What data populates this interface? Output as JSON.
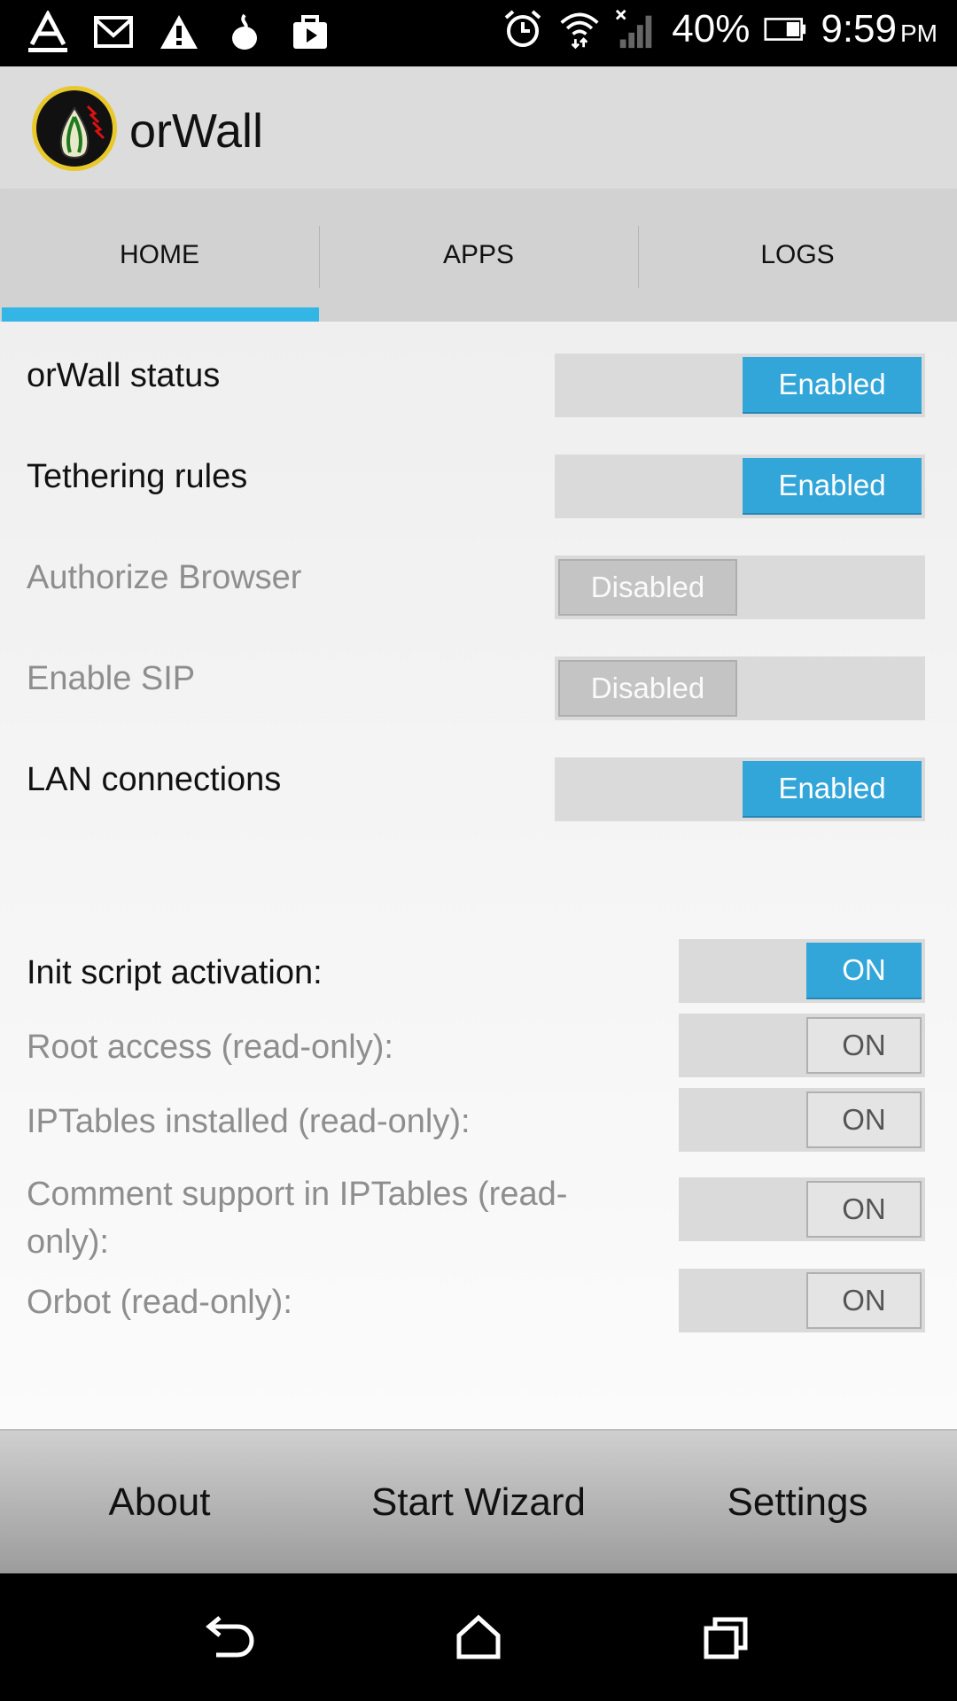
{
  "status_bar": {
    "icons_left": [
      "font-icon",
      "gmail-icon",
      "warning-icon",
      "lantern-icon",
      "play-store-icon"
    ],
    "icons_right": [
      "alarm-icon",
      "wifi-icon",
      "signal-icon"
    ],
    "battery": "40%",
    "time": "9:59",
    "ampm": "PM"
  },
  "app": {
    "title": "orWall"
  },
  "tabs": [
    {
      "label": "HOME",
      "selected": true
    },
    {
      "label": "APPS",
      "selected": false
    },
    {
      "label": "LOGS",
      "selected": false
    }
  ],
  "settings": [
    {
      "label": "orWall status",
      "state": "Enabled",
      "on": true,
      "enabled": true
    },
    {
      "label": "Tethering rules",
      "state": "Enabled",
      "on": true,
      "enabled": true
    },
    {
      "label": "Authorize Browser",
      "state": "Disabled",
      "on": false,
      "enabled": false
    },
    {
      "label": "Enable SIP",
      "state": "Disabled",
      "on": false,
      "enabled": false
    },
    {
      "label": "LAN connections",
      "state": "Enabled",
      "on": true,
      "enabled": true
    }
  ],
  "status_checks": [
    {
      "label": "Init script activation:",
      "state": "ON",
      "readonly": false
    },
    {
      "label": "Root access (read-only):",
      "state": "ON",
      "readonly": true
    },
    {
      "label": "IPTables installed (read-only):",
      "state": "ON",
      "readonly": true
    },
    {
      "label_line1": "Comment support in IPTables (read-",
      "label_line2": "only):",
      "state": "ON",
      "readonly": true
    },
    {
      "label": "Orbot (read-only):",
      "state": "ON",
      "readonly": true
    }
  ],
  "bottom_buttons": {
    "about": "About",
    "wizard": "Start Wizard",
    "settings": "Settings"
  },
  "colors": {
    "accent": "#33b5e5",
    "switch_on": "#33a6d9"
  }
}
